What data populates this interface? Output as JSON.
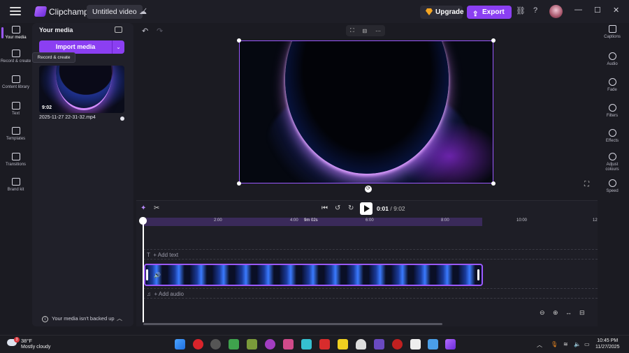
{
  "titlebar": {
    "app_name": "Clipchamp",
    "project_title": "Untitled video",
    "upgrade_label": "Upgrade",
    "export_label": "Export"
  },
  "left_rail": [
    {
      "label": "Your media",
      "icon": "folder-icon"
    },
    {
      "label": "Record & create",
      "icon": "camera-icon"
    },
    {
      "label": "Content library",
      "icon": "library-icon"
    },
    {
      "label": "Text",
      "icon": "text-icon"
    },
    {
      "label": "Templates",
      "icon": "templates-icon"
    },
    {
      "label": "Transitions",
      "icon": "transitions-icon"
    },
    {
      "label": "Brand kit",
      "icon": "brand-kit-icon"
    }
  ],
  "media_panel": {
    "title": "Your media",
    "import_label": "Import media",
    "tooltip": "Record & create",
    "item": {
      "duration": "9:02",
      "filename": "2025-11-27 22-31-32.mp4"
    },
    "backup_message": "Your media isn't backed up"
  },
  "right_rail": [
    {
      "label": "Captions",
      "icon": "captions-icon"
    },
    {
      "label": "Audio",
      "icon": "audio-icon"
    },
    {
      "label": "Fade",
      "icon": "fade-icon"
    },
    {
      "label": "Filters",
      "icon": "filters-icon"
    },
    {
      "label": "Effects",
      "icon": "effects-icon"
    },
    {
      "label": "Adjust colours",
      "icon": "adjust-colours-icon"
    },
    {
      "label": "Speed",
      "icon": "speed-icon"
    }
  ],
  "timeline": {
    "current_time": "0:01",
    "total_time": "/ 9:02",
    "ruler_ticks": [
      "2:00",
      "4:00",
      "9m 02s",
      "6:00",
      "8:00",
      "10:00",
      "12"
    ],
    "add_text": "+ Add text",
    "add_audio": "+ Add audio"
  },
  "taskbar": {
    "temperature": "38°F",
    "weather": "Mostly cloudy",
    "weather_badge": "3",
    "time": "10:45 PM",
    "date": "11/27/2025"
  }
}
